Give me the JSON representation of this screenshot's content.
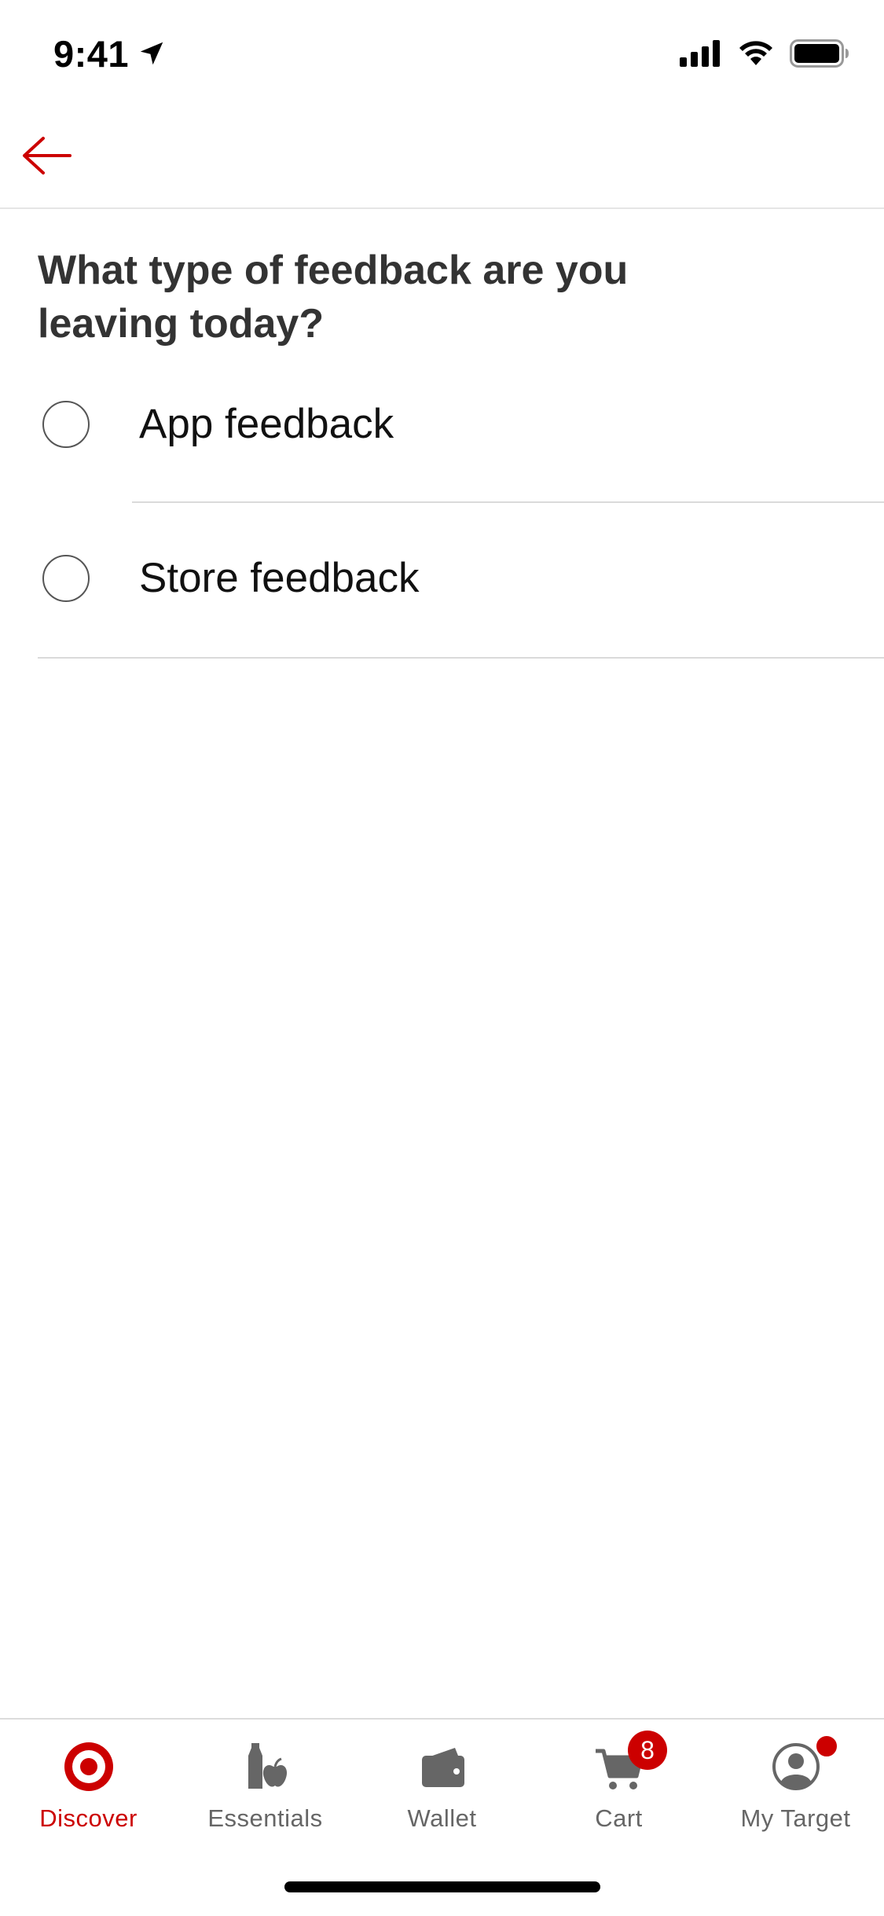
{
  "status_bar": {
    "time": "9:41",
    "icons": [
      "location-arrow-icon",
      "cellular-signal-icon",
      "wifi-icon",
      "battery-icon"
    ]
  },
  "header": {
    "back_icon": "arrow-left-icon"
  },
  "colors": {
    "accent": "#cc0000",
    "text_dark": "#333333",
    "tab_inactive": "#666666",
    "divider": "#dadada"
  },
  "question": "What type of feedback are you leaving today?",
  "options": [
    {
      "label": "App feedback",
      "selected": false
    },
    {
      "label": "Store feedback",
      "selected": false
    }
  ],
  "tabs": [
    {
      "label": "Discover",
      "icon": "target-bullseye-icon",
      "active": true
    },
    {
      "label": "Essentials",
      "icon": "grocery-icon",
      "active": false
    },
    {
      "label": "Wallet",
      "icon": "wallet-icon",
      "active": false
    },
    {
      "label": "Cart",
      "icon": "cart-icon",
      "active": false,
      "badge": "8"
    },
    {
      "label": "My Target",
      "icon": "profile-icon",
      "active": false,
      "notification": true
    }
  ]
}
